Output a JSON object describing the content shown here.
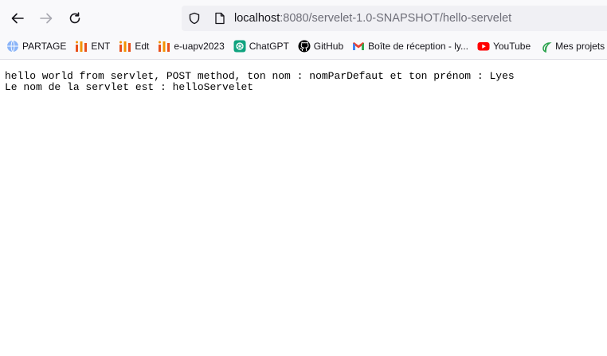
{
  "browser": {
    "url_host": "localhost",
    "url_rest": ":8080/servelet-1.0-SNAPSHOT/hello-servelet"
  },
  "bookmarks": [
    {
      "label": "PARTAGE",
      "icon": "globe-icon",
      "color": "#8ab4f8"
    },
    {
      "label": "ENT",
      "icon": "university-logo-icon",
      "color": "#e8501c"
    },
    {
      "label": "Edt",
      "icon": "university-logo-icon",
      "color": "#e8501c"
    },
    {
      "label": "e-uapv2023",
      "icon": "university-logo-icon",
      "color": "#e8501c"
    },
    {
      "label": "ChatGPT",
      "icon": "chatgpt-icon",
      "color": "#10a37f"
    },
    {
      "label": "GitHub",
      "icon": "github-icon",
      "color": "#000000"
    },
    {
      "label": "Boîte de réception - ly...",
      "icon": "gmail-icon",
      "color": "#ea4335"
    },
    {
      "label": "YouTube",
      "icon": "youtube-icon",
      "color": "#ff0000"
    },
    {
      "label": "Mes projets -",
      "icon": "leaf-icon",
      "color": "#2ea44f"
    }
  ],
  "page": {
    "line1": "hello world from servlet, POST method, ton nom : nomParDefaut et ton prénom : Lyes",
    "line2": "Le nom de la servlet est : helloServelet"
  }
}
